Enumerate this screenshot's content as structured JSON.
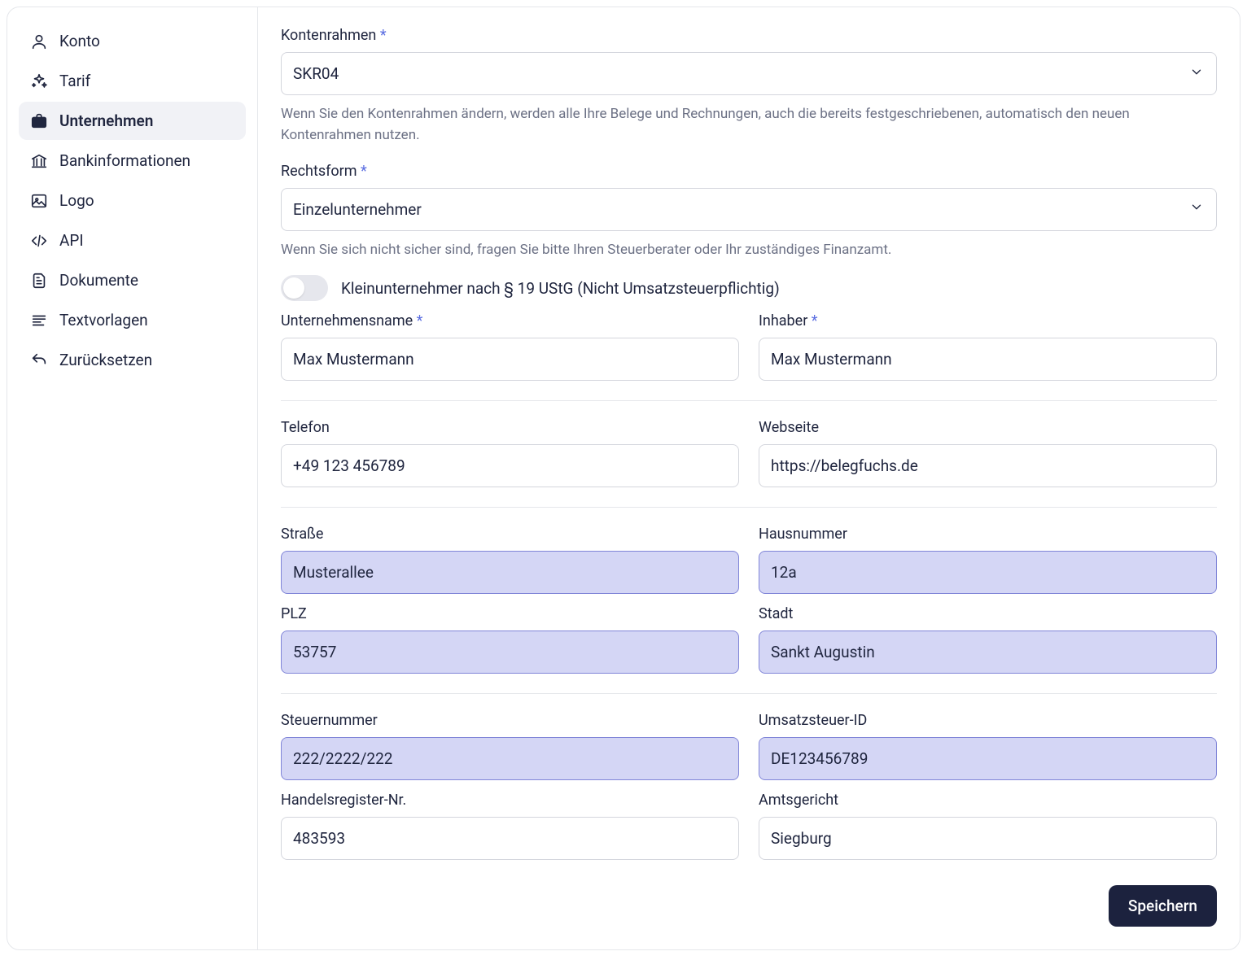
{
  "sidebar": {
    "items": [
      {
        "label": "Konto"
      },
      {
        "label": "Tarif"
      },
      {
        "label": "Unternehmen"
      },
      {
        "label": "Bankinformationen"
      },
      {
        "label": "Logo"
      },
      {
        "label": "API"
      },
      {
        "label": "Dokumente"
      },
      {
        "label": "Textvorlagen"
      },
      {
        "label": "Zurücksetzen"
      }
    ]
  },
  "form": {
    "kontenrahmen_label": "Kontenrahmen",
    "kontenrahmen_value": "SKR04",
    "kontenrahmen_help": "Wenn Sie den Kontenrahmen ändern, werden alle Ihre Belege und Rechnungen, auch die bereits festgeschriebenen, automatisch den neuen Kontenrahmen nutzen.",
    "rechtsform_label": "Rechtsform",
    "rechtsform_value": "Einzelunternehmer",
    "rechtsform_help": "Wenn Sie sich nicht sicher sind, fragen Sie bitte Ihren Steuerberater oder Ihr zuständiges Finanzamt.",
    "kleinunternehmer_label": "Kleinunternehmer nach § 19 UStG (Nicht Umsatzsteuerpflichtig)",
    "unternehmensname_label": "Unternehmensname",
    "unternehmensname_value": "Max Mustermann",
    "inhaber_label": "Inhaber",
    "inhaber_value": "Max Mustermann",
    "telefon_label": "Telefon",
    "telefon_value": "+49 123 456789",
    "webseite_label": "Webseite",
    "webseite_value": "https://belegfuchs.de",
    "strasse_label": "Straße",
    "strasse_value": "Musterallee",
    "hausnummer_label": "Hausnummer",
    "hausnummer_value": "12a",
    "plz_label": "PLZ",
    "plz_value": "53757",
    "stadt_label": "Stadt",
    "stadt_value": "Sankt Augustin",
    "steuernummer_label": "Steuernummer",
    "steuernummer_value": "222/2222/222",
    "ustid_label": "Umsatzsteuer-ID",
    "ustid_value": "DE123456789",
    "handelsregister_label": "Handelsregister-Nr.",
    "handelsregister_value": "483593",
    "amtsgericht_label": "Amtsgericht",
    "amtsgericht_value": "Siegburg"
  },
  "actions": {
    "save_label": "Speichern"
  },
  "required_marker": "*"
}
